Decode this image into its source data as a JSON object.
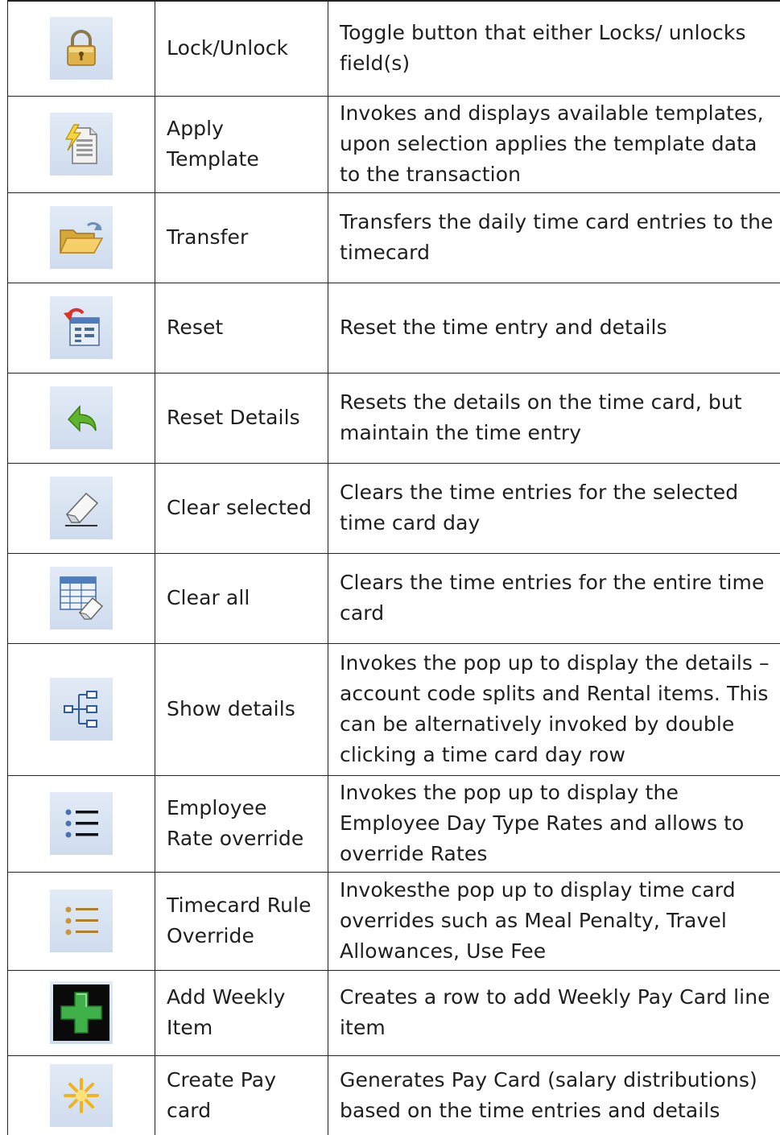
{
  "rows": [
    {
      "icon": "lock-icon",
      "name": "Lock/Unlock",
      "description": "Toggle button that either Locks/ unlocks field(s)"
    },
    {
      "icon": "apply-template-icon",
      "name": "Apply Template",
      "description": "Invokes and displays available templates, upon selection applies the template data to the transaction"
    },
    {
      "icon": "transfer-folder-icon",
      "name": "Transfer",
      "description": " Transfers the daily time card entries to the timecard"
    },
    {
      "icon": "reset-icon",
      "name": "Reset",
      "description": "Reset the time entry and details"
    },
    {
      "icon": "reset-details-icon",
      "name": "Reset Details",
      "description": "Resets the details on the time card, but maintain the time entry"
    },
    {
      "icon": "eraser-icon",
      "name": "Clear selected",
      "description": "Clears the time entries for the selected time card day"
    },
    {
      "icon": "clear-all-grid-icon",
      "name": "Clear all",
      "description": "Clears the time entries for the entire time card"
    },
    {
      "icon": "tree-details-icon",
      "name": "Show details",
      "description": "Invokes the pop up to display the details – account code splits and Rental items. This can be alternatively invoked by double clicking a time card day row"
    },
    {
      "icon": "rate-list-icon",
      "name": "Employee Rate override",
      "description": "Invokes the pop up to display the Employee Day Type Rates and allows to override Rates"
    },
    {
      "icon": "rule-list-icon",
      "name": "Timecard Rule Override",
      "description": " Invokesthe pop up to display time card overrides such as Meal Penalty, Travel Allowances, Use Fee"
    },
    {
      "icon": "add-plus-icon",
      "name": "Add Weekly Item",
      "description": "Creates a row to add Weekly Pay Card line item"
    },
    {
      "icon": "create-paycard-icon",
      "name": "Create Pay card",
      "description": "Generates Pay Card (salary distributions) based on the time entries and details"
    }
  ]
}
